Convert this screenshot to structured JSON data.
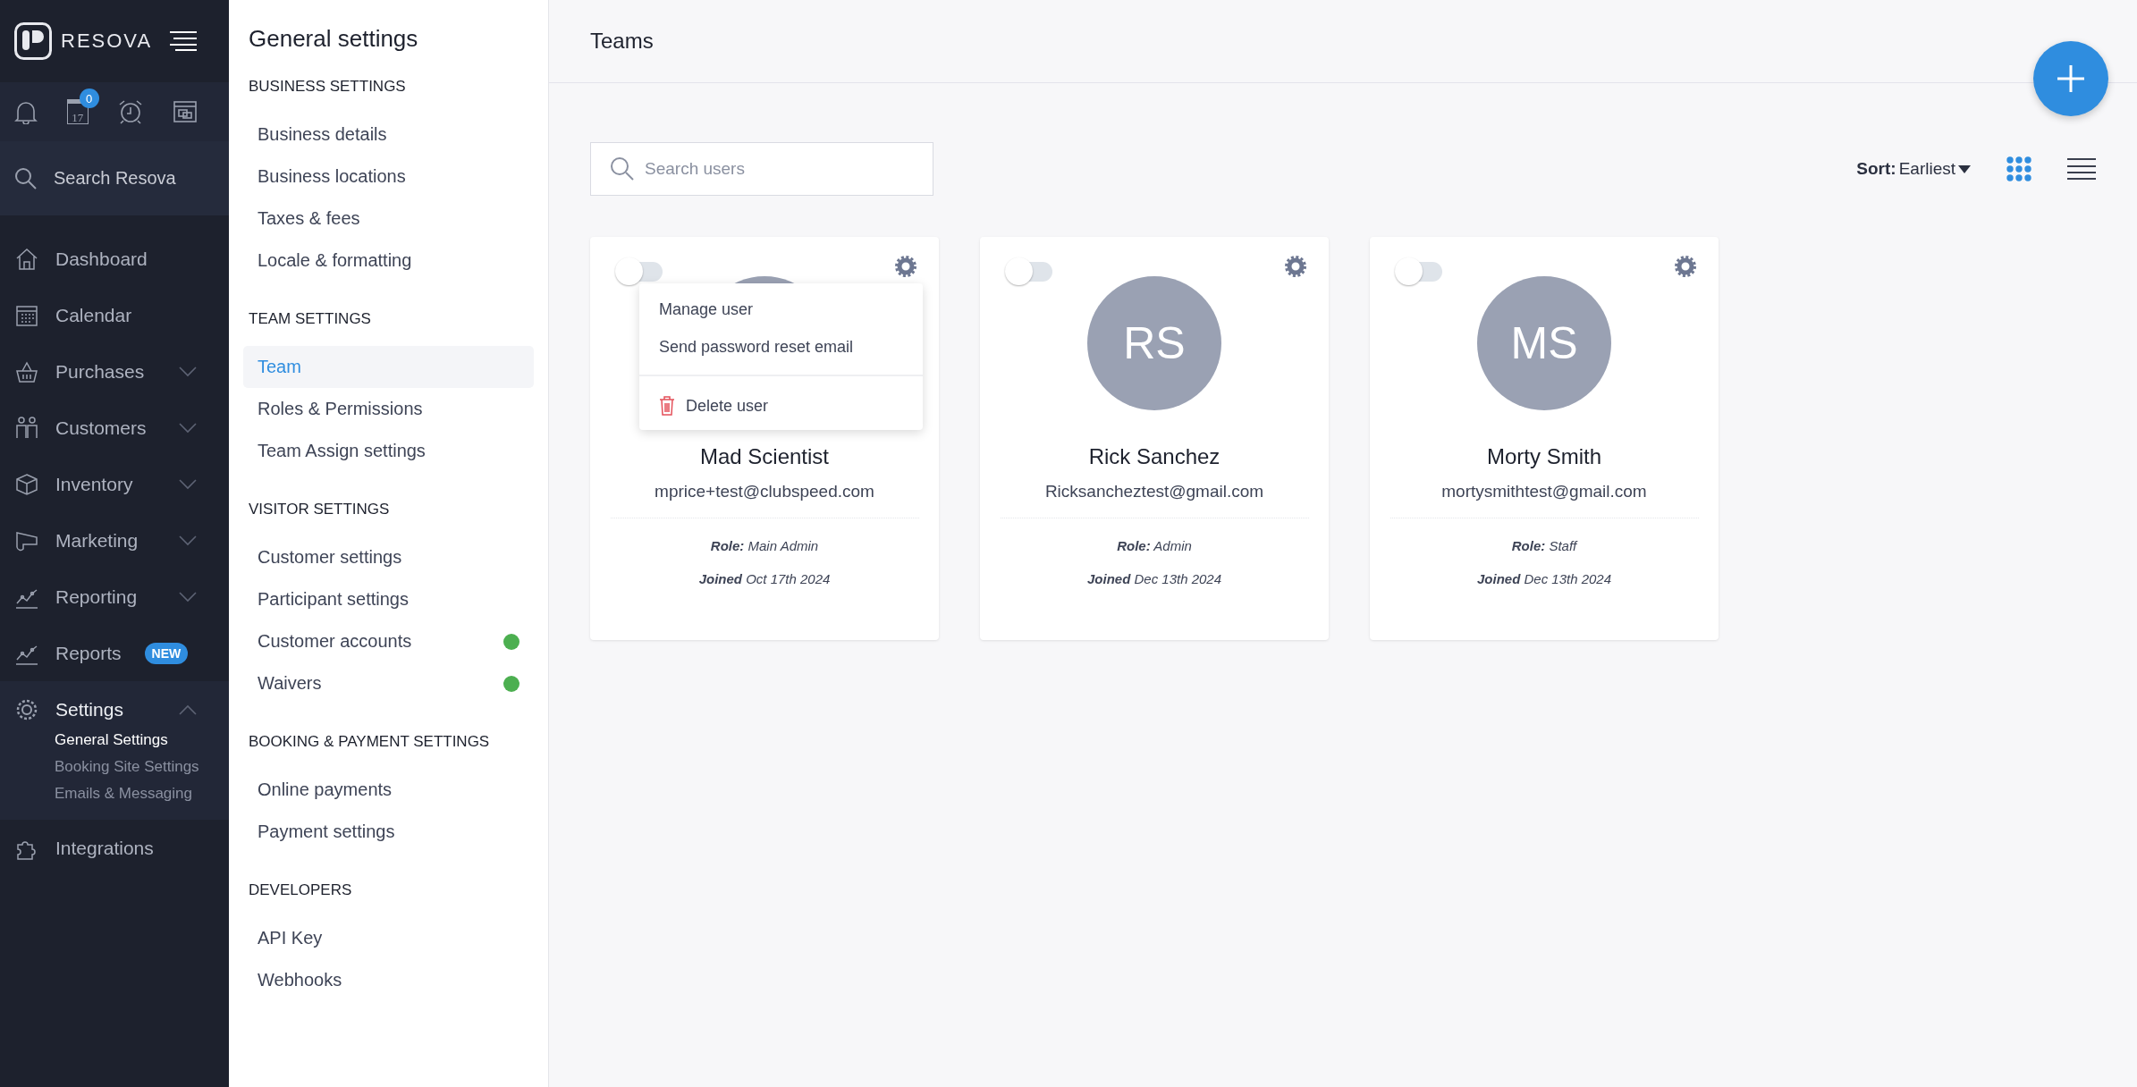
{
  "brand": {
    "name": "RESOVA"
  },
  "quick_icons": {
    "notifications_badge": "0",
    "calendar_day": "17"
  },
  "sidebar_search": {
    "label": "Search Resova"
  },
  "nav": [
    {
      "label": "Dashboard",
      "expandable": false,
      "selected": false
    },
    {
      "label": "Calendar",
      "expandable": false,
      "selected": false
    },
    {
      "label": "Purchases",
      "expandable": true,
      "expanded": false,
      "selected": false
    },
    {
      "label": "Customers",
      "expandable": true,
      "expanded": false,
      "selected": false
    },
    {
      "label": "Inventory",
      "expandable": true,
      "expanded": false,
      "selected": false
    },
    {
      "label": "Marketing",
      "expandable": true,
      "expanded": false,
      "selected": false
    },
    {
      "label": "Reporting",
      "expandable": true,
      "expanded": false,
      "selected": false
    },
    {
      "label": "Reports",
      "badge": "NEW",
      "expandable": false,
      "selected": false
    },
    {
      "label": "Settings",
      "expandable": true,
      "expanded": true,
      "selected": true,
      "children": [
        {
          "label": "General Settings",
          "selected": true
        },
        {
          "label": "Booking Site Settings",
          "selected": false
        },
        {
          "label": "Emails & Messaging",
          "selected": false
        }
      ]
    },
    {
      "label": "Integrations",
      "expandable": false,
      "selected": false
    }
  ],
  "settings_panel": {
    "title": "General settings",
    "sections": [
      {
        "heading": "BUSINESS SETTINGS",
        "items": [
          {
            "label": "Business details",
            "selected": false,
            "status_on": false
          },
          {
            "label": "Business locations",
            "selected": false,
            "status_on": false
          },
          {
            "label": "Taxes & fees",
            "selected": false,
            "status_on": false
          },
          {
            "label": "Locale & formatting",
            "selected": false,
            "status_on": false
          }
        ]
      },
      {
        "heading": "TEAM SETTINGS",
        "items": [
          {
            "label": "Team",
            "selected": true,
            "status_on": false
          },
          {
            "label": "Roles & Permissions",
            "selected": false,
            "status_on": false
          },
          {
            "label": "Team Assign settings",
            "selected": false,
            "status_on": false
          }
        ]
      },
      {
        "heading": "VISITOR SETTINGS",
        "items": [
          {
            "label": "Customer settings",
            "selected": false,
            "status_on": false
          },
          {
            "label": "Participant settings",
            "selected": false,
            "status_on": false
          },
          {
            "label": "Customer accounts",
            "selected": false,
            "status_on": true
          },
          {
            "label": "Waivers",
            "selected": false,
            "status_on": true
          }
        ]
      },
      {
        "heading": "BOOKING & PAYMENT SETTINGS",
        "items": [
          {
            "label": "Online payments",
            "selected": false,
            "status_on": false
          },
          {
            "label": "Payment settings",
            "selected": false,
            "status_on": false
          }
        ]
      },
      {
        "heading": "DEVELOPERS",
        "items": [
          {
            "label": "API Key",
            "selected": false,
            "status_on": false
          },
          {
            "label": "Webhooks",
            "selected": false,
            "status_on": false
          }
        ]
      }
    ]
  },
  "page": {
    "title": "Teams"
  },
  "search": {
    "placeholder": "Search users"
  },
  "sort": {
    "label": "Sort:",
    "value": "Earliest"
  },
  "views": [
    {
      "kind": "grid",
      "selected": true
    },
    {
      "kind": "list",
      "selected": false
    }
  ],
  "users": [
    {
      "name": "Mad Scientist",
      "email": "mprice+test@clubspeed.com",
      "role": "**Role:** Main Admin",
      "joined": "**Joined** Oct 17th 2024",
      "on": false,
      "menu": [
        {
          "label": "Manage user",
          "kind": "normal"
        },
        {
          "label": "Send password reset email",
          "kind": "normal"
        },
        {
          "label": "Delete user",
          "kind": "danger"
        }
      ]
    },
    {
      "initials": "RS",
      "name": "Rick Sanchez",
      "email": "Ricksancheztest@gmail.com",
      "role": "**Role:** Admin",
      "joined": "**Joined** Dec 13th 2024",
      "on": false
    },
    {
      "initials": "MS",
      "name": "Morty Smith",
      "email": "mortysmithtest@gmail.com",
      "role": "**Role:** Staff",
      "joined": "**Joined** Dec 13th 2024",
      "on": false
    }
  ]
}
